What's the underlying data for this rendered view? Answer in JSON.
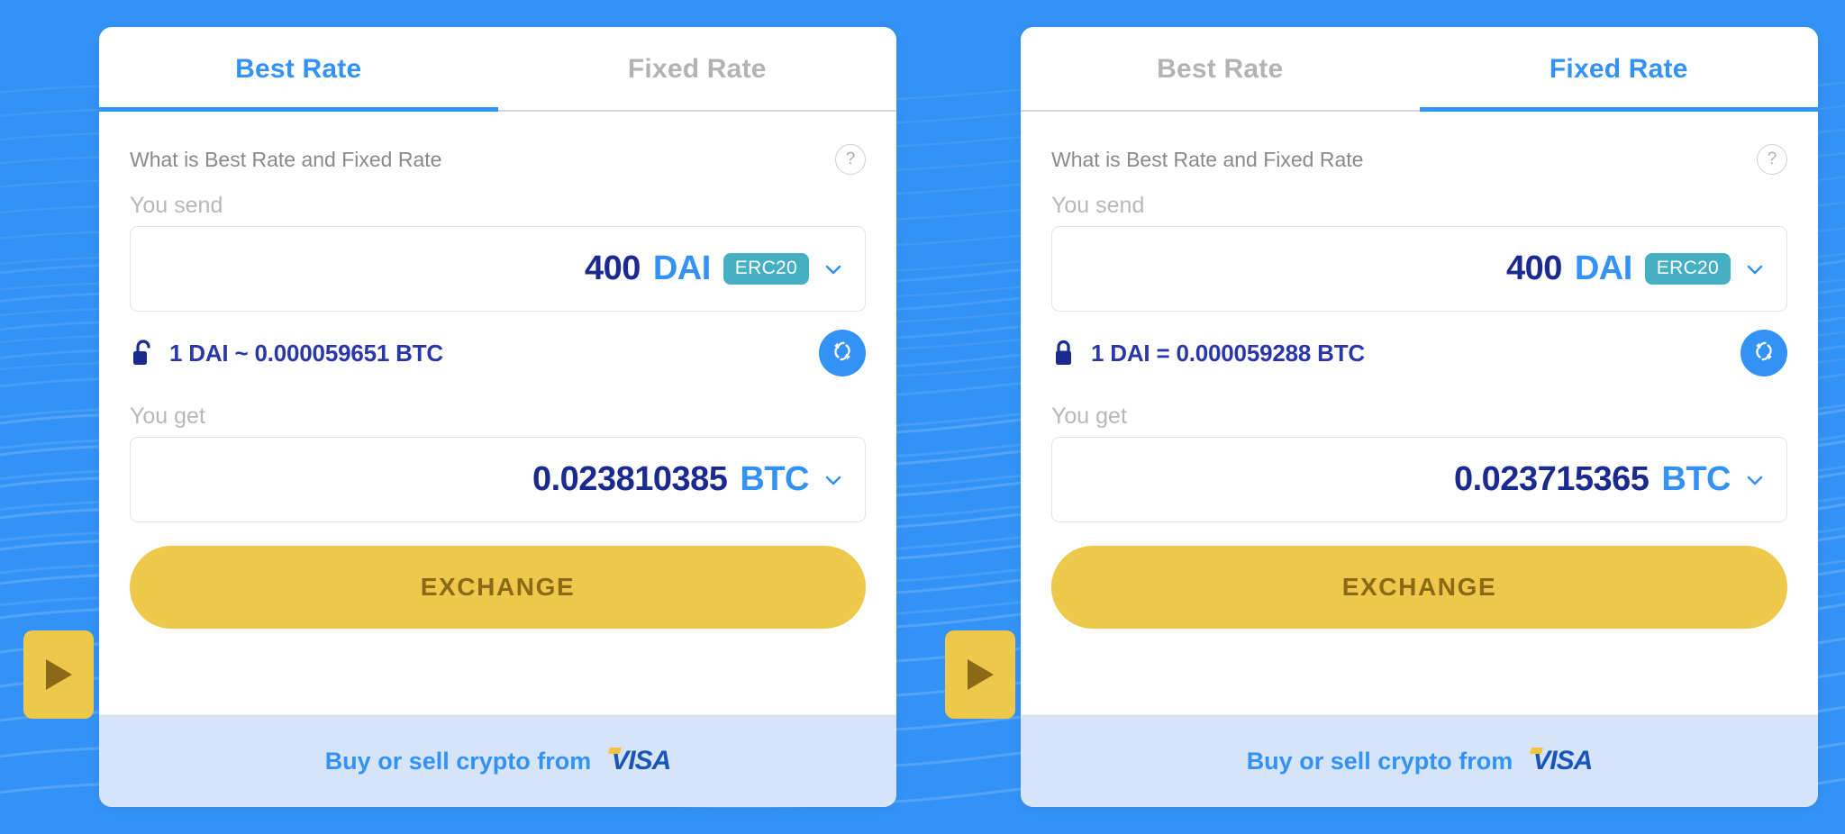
{
  "theme": {
    "background_blue": "#3392f5",
    "accent_blue": "#3392f5",
    "value_navy": "#1b2a8f",
    "rate_navy": "#2a37a8",
    "chip_teal": "#45b0c4",
    "button_gold": "#edc84b",
    "button_gold_text": "#8a6a16",
    "footer_band": "#d5e4f8",
    "muted_gray": "#b8b8b8"
  },
  "widgets": [
    {
      "id": "best-rate-widget",
      "tabs": [
        {
          "label": "Best Rate",
          "active": true
        },
        {
          "label": "Fixed Rate",
          "active": false
        }
      ],
      "info": {
        "text": "What is Best Rate and Fixed Rate",
        "help_icon": "question-mark-icon",
        "help_glyph": "?"
      },
      "send": {
        "label": "You send",
        "amount": "400",
        "ticker": "DAI",
        "network_chip": "ERC20",
        "chevron_icon": "chevron-down-icon"
      },
      "rate": {
        "lock_icon": "padlock-open-icon",
        "locked": false,
        "text": "1 DAI ~ 0.000059651 BTC",
        "base_currency": "DAI",
        "base_amount": "1",
        "operator": "~",
        "quote_amount": "0.000059651",
        "quote_currency": "BTC",
        "refresh_icon": "refresh-icon"
      },
      "get": {
        "label": "You get",
        "amount": "0.023810385",
        "ticker": "BTC",
        "chevron_icon": "chevron-down-icon"
      },
      "exchange_button": "EXCHANGE",
      "footer": {
        "text": "Buy or sell crypto from",
        "brand": "VISA"
      },
      "play_tab_icon": "play-triangle-icon"
    },
    {
      "id": "fixed-rate-widget",
      "tabs": [
        {
          "label": "Best Rate",
          "active": false
        },
        {
          "label": "Fixed Rate",
          "active": true
        }
      ],
      "info": {
        "text": "What is Best Rate and Fixed Rate",
        "help_icon": "question-mark-icon",
        "help_glyph": "?"
      },
      "send": {
        "label": "You send",
        "amount": "400",
        "ticker": "DAI",
        "network_chip": "ERC20",
        "chevron_icon": "chevron-down-icon"
      },
      "rate": {
        "lock_icon": "padlock-closed-icon",
        "locked": true,
        "text": "1 DAI = 0.000059288 BTC",
        "base_currency": "DAI",
        "base_amount": "1",
        "operator": "=",
        "quote_amount": "0.000059288",
        "quote_currency": "BTC",
        "refresh_icon": "refresh-icon"
      },
      "get": {
        "label": "You get",
        "amount": "0.023715365",
        "ticker": "BTC",
        "chevron_icon": "chevron-down-icon"
      },
      "exchange_button": "EXCHANGE",
      "footer": {
        "text": "Buy or sell crypto from",
        "brand": "VISA"
      },
      "play_tab_icon": "play-triangle-icon"
    }
  ]
}
